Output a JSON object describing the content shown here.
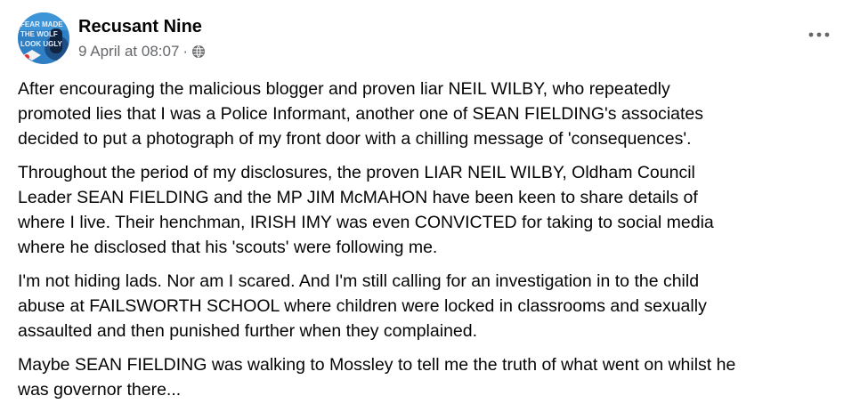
{
  "post": {
    "author": "Recusant Nine",
    "timestamp": "9 April at 08:07",
    "separator": "·",
    "audience_icon": "globe-icon",
    "more_icon": "more-horizontal-icon",
    "avatar_text": [
      "FEAR MADE",
      "THE WOLF",
      "LOOK UGLY"
    ],
    "colors": {
      "author": "#050505",
      "meta": "#65676b",
      "avatar_bg": "#2f7fc4"
    },
    "paragraphs": [
      "After encouraging the malicious blogger and proven liar NEIL WILBY, who repeatedly\npromoted lies that I was a Police Informant, another one of SEAN FIELDING's associates\ndecided to put a photograph of my front door with a chilling message of 'consequences'.",
      "Throughout the period of my disclosures, the proven LIAR NEIL WILBY, Oldham Council\nLeader SEAN FIELDING and the MP JIM McMAHON have been keen to share details of\nwhere I live. Their henchman, IRISH IMY was even CONVICTED for taking to social media\nwhere he disclosed that his 'scouts' were following me.",
      "I'm not hiding lads. Nor am I scared. And I'm still calling for an investigation in to the child\nabuse at FAILSWORTH SCHOOL where children were locked in classrooms and sexually\nassaulted and then punished further when they complained.",
      "Maybe SEAN FIELDING was walking to Mossley to tell me the truth of what went on whilst he\nwas governor there..."
    ]
  }
}
